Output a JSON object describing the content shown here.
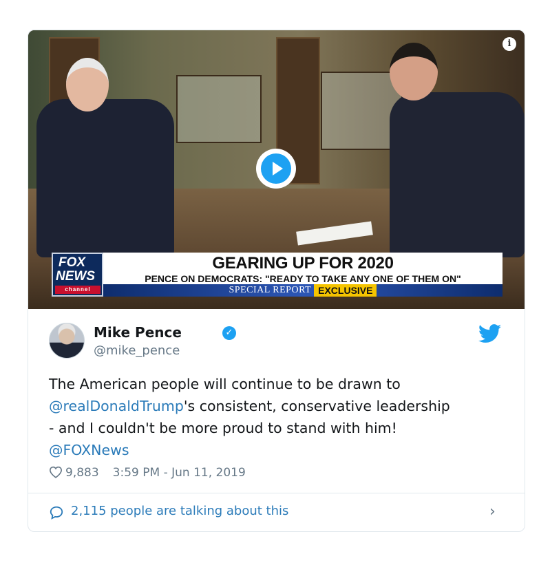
{
  "video": {
    "chyron_headline": "GEARING UP FOR 2020",
    "chyron_subline": "PENCE ON DEMOCRATS: \"READY TO TAKE ANY ONE OF THEM ON\"",
    "chyron_show": "SPECIAL REPORT",
    "chyron_badge": "EXCLUSIVE",
    "logo_line1": "FOX",
    "logo_line2": "NEWS",
    "logo_line3": "channel",
    "info_icon": "info-icon",
    "play_icon": "play-icon"
  },
  "tweet": {
    "author_name": "Mike Pence",
    "handle": "@mike_pence",
    "verified_icon": "verified-badge-icon",
    "bird_icon": "twitter-bird-icon",
    "line1": "The American people will continue to be drawn to",
    "mention1": "@realDonaldTrump",
    "line2_rest": "'s consistent, conservative leadership",
    "line3": "- and I couldn't be more proud to stand with him!",
    "mention2": "@FOXNews",
    "likes": "9,883",
    "timestamp": "3:59 PM - Jun 11, 2019",
    "talking": "2,115 people are talking about this"
  },
  "colors": {
    "link": "#2b7bb9",
    "twitter_blue": "#1da1f2",
    "muted": "#657786"
  }
}
